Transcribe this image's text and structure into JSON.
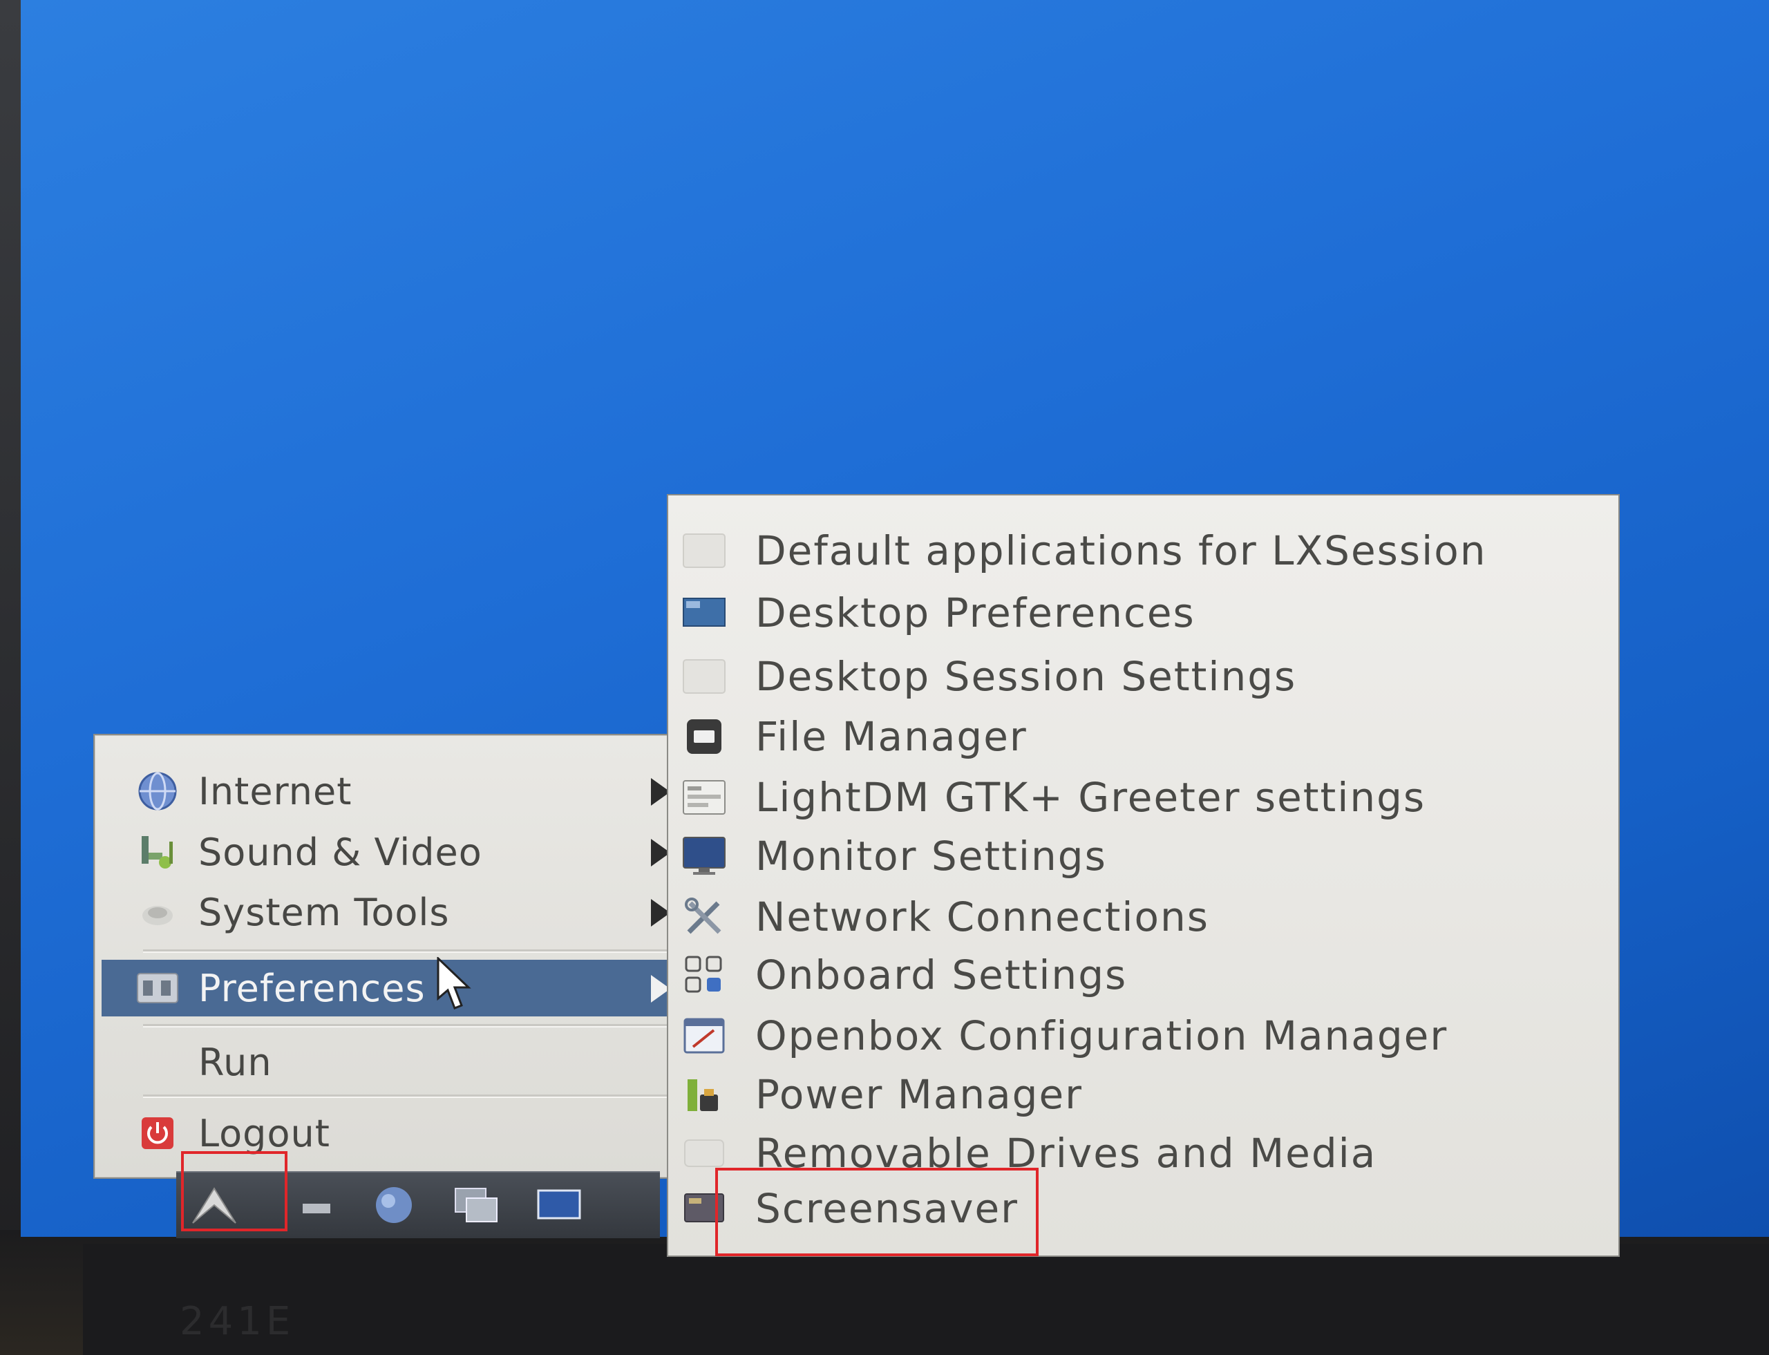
{
  "main_menu": {
    "items": [
      {
        "label": "Internet",
        "icon": "globe-icon",
        "submenu": true
      },
      {
        "label": "Sound & Video",
        "icon": "music-icon",
        "submenu": true
      },
      {
        "label": "System Tools",
        "icon": "gear-icon",
        "submenu": true
      },
      {
        "label": "Preferences",
        "icon": "preferences-icon",
        "submenu": true,
        "selected": true
      },
      {
        "label": "Run",
        "icon": "",
        "submenu": false
      },
      {
        "label": "Logout",
        "icon": "power-icon",
        "submenu": false
      }
    ]
  },
  "preferences_submenu": {
    "items": [
      {
        "label": "Default applications for LXSession",
        "icon": "lxsession-icon"
      },
      {
        "label": "Desktop Preferences",
        "icon": "desktop-icon"
      },
      {
        "label": "Desktop Session Settings",
        "icon": "session-icon"
      },
      {
        "label": "File Manager",
        "icon": "file-manager-icon"
      },
      {
        "label": "LightDM GTK+ Greeter settings",
        "icon": "greeter-icon"
      },
      {
        "label": "Monitor Settings",
        "icon": "monitor-icon"
      },
      {
        "label": "Network Connections",
        "icon": "network-tools-icon"
      },
      {
        "label": "Onboard Settings",
        "icon": "keyboard-icon"
      },
      {
        "label": "Openbox Configuration Manager",
        "icon": "openbox-icon"
      },
      {
        "label": "Power Manager",
        "icon": "battery-icon"
      },
      {
        "label": "Removable Drives and Media",
        "icon": "drive-icon"
      },
      {
        "label": "Screensaver",
        "icon": "screensaver-icon"
      }
    ]
  },
  "taskbar": {
    "items": [
      "start-menu-icon",
      "show-desktop-icon",
      "web-browser-icon",
      "window-switcher-icon",
      "terminal-icon"
    ]
  },
  "monitor_brand": "241E",
  "colors": {
    "desktop": "#1f6ed6",
    "menu_bg": "#e6e5e1",
    "selected": "#4a6a94",
    "annotation": "#e0262a"
  }
}
